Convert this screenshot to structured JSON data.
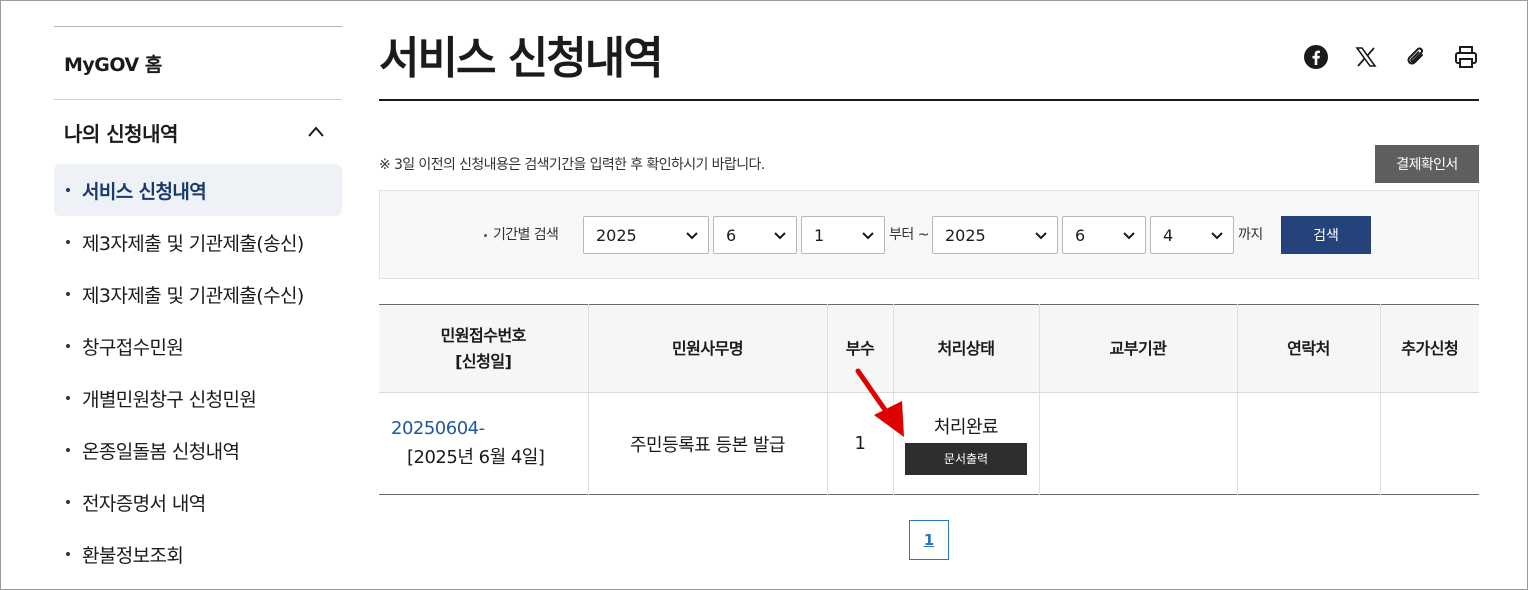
{
  "sidebar": {
    "home": "MyGOV 홈",
    "group_title": "나의 신청내역",
    "items": [
      {
        "label": "서비스 신청내역"
      },
      {
        "label": "제3자제출 및 기관제출(송신)"
      },
      {
        "label": "제3자제출 및 기관제출(수신)"
      },
      {
        "label": "창구접수민원"
      },
      {
        "label": "개별민원창구 신청민원"
      },
      {
        "label": "온종일돌봄 신청내역"
      },
      {
        "label": "전자증명서 내역"
      },
      {
        "label": "환불정보조회"
      }
    ]
  },
  "header": {
    "title": "서비스 신청내역",
    "share_icons": [
      "facebook-icon",
      "x-icon",
      "paperclip-icon",
      "print-icon"
    ]
  },
  "notice": "※ 3일 이전의 신청내용은 검색기간을 입력한 후 확인하시기 바랍니다.",
  "confirm_button": "결제확인서",
  "search": {
    "label": "기간별 검색",
    "from_year": "2025",
    "from_month": "6",
    "from_day": "1",
    "from_text": "부터 ~",
    "to_year": "2025",
    "to_month": "6",
    "to_day": "4",
    "to_text": "까지",
    "button": "검색"
  },
  "table": {
    "headers": {
      "receipt_line1": "민원접수번호",
      "receipt_line2": "[신청일]",
      "service": "민원사무명",
      "copies": "부수",
      "status": "처리상태",
      "issuer": "교부기관",
      "contact": "연락처",
      "extra": "추가신청"
    },
    "rows": [
      {
        "receipt_no": "20250604-",
        "date": "[2025년 6월 4일]",
        "service": "주민등록표 등본 발급",
        "copies": "1",
        "status": "처리완료",
        "print_button": "문서출력",
        "issuer": "",
        "contact": "",
        "extra": ""
      }
    ]
  },
  "pagination": {
    "current": "1"
  },
  "colors": {
    "accent": "#24437a",
    "link": "#1e5a9c",
    "arrow": "#e00000"
  }
}
